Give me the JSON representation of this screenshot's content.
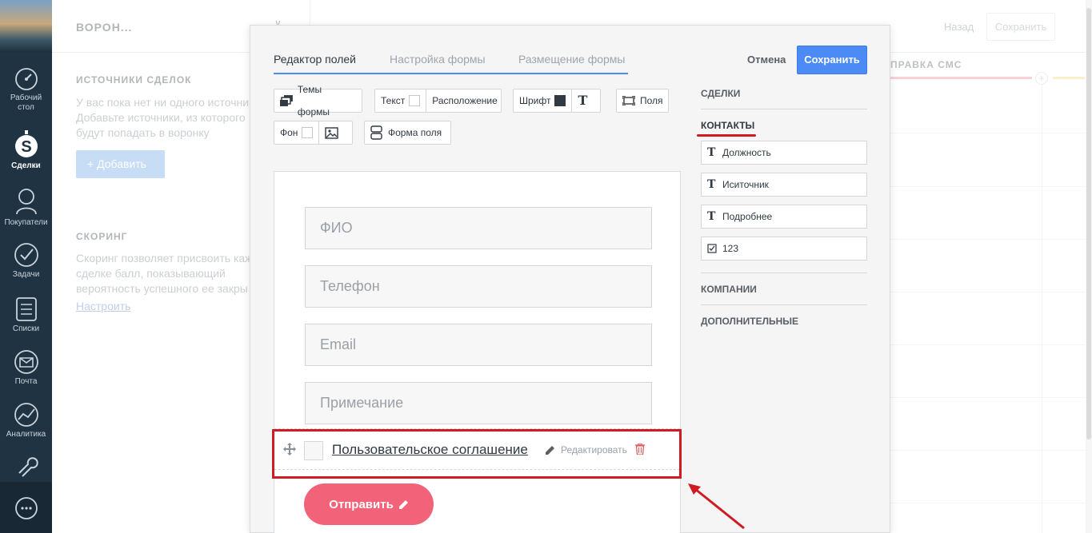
{
  "sidebar": {
    "items": [
      {
        "label1": "Рабочий",
        "label2": "стол"
      },
      {
        "label1": "Сделки",
        "label2": ""
      },
      {
        "label1": "Покупатели",
        "label2": ""
      },
      {
        "label1": "Задачи",
        "label2": ""
      },
      {
        "label1": "Списки",
        "label2": ""
      },
      {
        "label1": "Почта",
        "label2": ""
      },
      {
        "label1": "Аналитика",
        "label2": ""
      }
    ]
  },
  "background": {
    "title": "ВОРОН...",
    "back_label": "Назад",
    "save_label": "Сохранить",
    "sources_title": "ИСТОЧНИКИ СДЕЛОК",
    "sources_text": [
      "У вас пока нет ни одного источни",
      "Добавьте источники, из которого",
      "будут попадать в воронку"
    ],
    "add_label": "+ Добавить",
    "scoring_title": "СКОРИНГ",
    "scoring_text": [
      "Скоринг позволяет присвоить каж",
      "сделке балл, показывающий",
      "вероятность успешного ее закры"
    ],
    "configure_link": "Настроить",
    "column_title": "ПРАВКА СМС"
  },
  "modal": {
    "tabs": [
      "Редактор полей",
      "Настройка формы",
      "Размещение формы"
    ],
    "active_tab": 0,
    "cancel_label": "Отмена",
    "save_label": "Сохранить",
    "toolbar": {
      "themes_label": "Темы формы",
      "text_label": "Текст",
      "layout_label": "Расположение",
      "font_label": "Шрифт",
      "fields_label": "Поля",
      "bg_label": "Фон",
      "field_shape_label": "Форма поля"
    },
    "form": {
      "fields": [
        "ФИО",
        "Телефон",
        "Email",
        "Примечание"
      ],
      "agreement_label": "Пользовательское соглашение",
      "edit_label": "Редактировать",
      "submit_label": "Отправить"
    },
    "fields_panel": {
      "sections": [
        "СДЕЛКИ",
        "КОНТАКТЫ",
        "КОМПАНИИ",
        "ДОПОЛНИТЕЛЬНЫЕ"
      ],
      "contact_fields": [
        {
          "label": "Должность",
          "icon": "text-icon"
        },
        {
          "label": "Иситочник",
          "icon": "text-icon"
        },
        {
          "label": "Подробнее",
          "icon": "text-icon"
        },
        {
          "label": "123",
          "icon": "checkbox-icon"
        }
      ]
    }
  },
  "colors": {
    "sidebar_bg": "#1f3342",
    "accent_blue": "#4c8bf5",
    "submit_pink": "#f2637a",
    "highlight_red": "#cf1b23"
  }
}
